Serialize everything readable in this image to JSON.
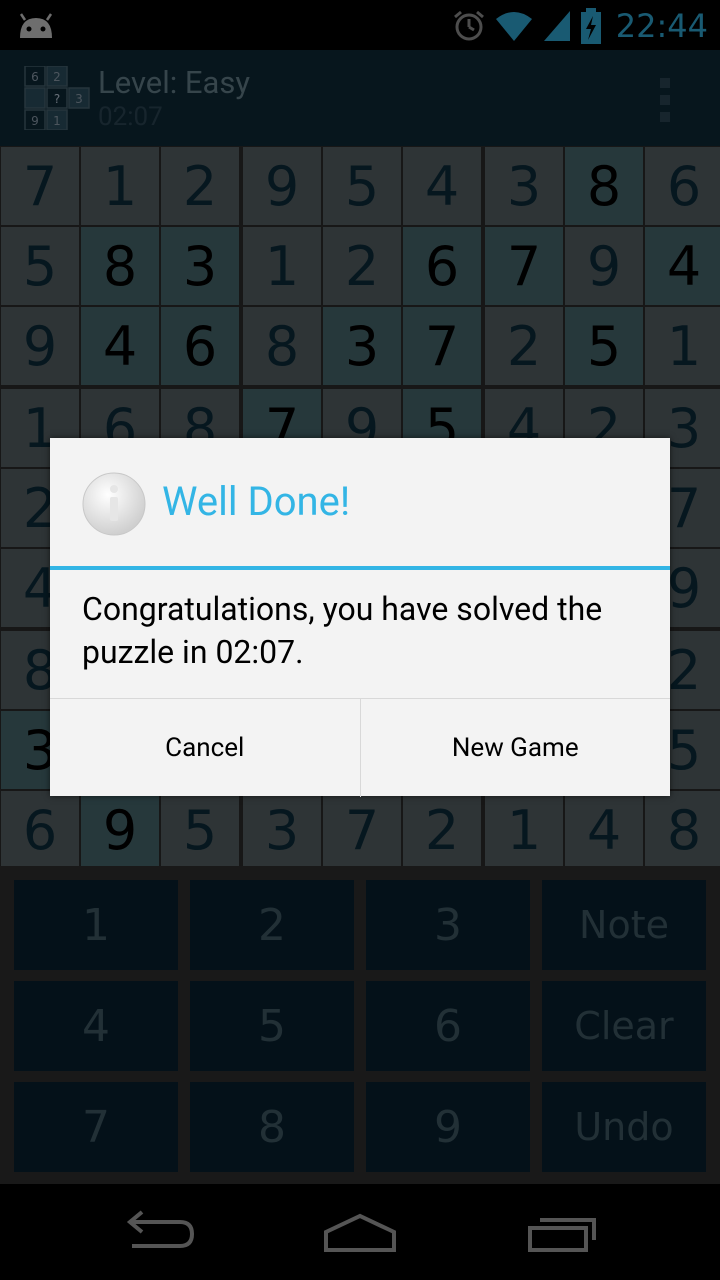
{
  "status_bar": {
    "time": "22:44",
    "icons": [
      "android-icon",
      "alarm-icon",
      "wifi-icon",
      "signal-icon",
      "battery-charging-icon"
    ]
  },
  "app_bar": {
    "title": "Level: Easy",
    "timer": "02:07",
    "logo_digits": [
      "6",
      "2",
      "?",
      "3",
      "9",
      "1"
    ],
    "menu_icon": "overflow-menu-icon"
  },
  "board": {
    "rows": [
      [
        "7",
        "1",
        "2",
        "9",
        "5",
        "4",
        "3",
        "8",
        "6"
      ],
      [
        "5",
        "8",
        "3",
        "1",
        "2",
        "6",
        "7",
        "9",
        "4"
      ],
      [
        "9",
        "4",
        "6",
        "8",
        "3",
        "7",
        "2",
        "5",
        "1"
      ],
      [
        "1",
        "6",
        "8",
        "7",
        "9",
        "5",
        "4",
        "2",
        "3"
      ],
      [
        "2",
        "",
        "",
        "",
        "",
        "",
        "",
        "",
        "7"
      ],
      [
        "4",
        "",
        "",
        "",
        "",
        "",
        "",
        "",
        "9"
      ],
      [
        "8",
        "",
        "",
        "",
        "",
        "",
        "",
        "",
        "2"
      ],
      [
        "3",
        "",
        "",
        "",
        "",
        "",
        "",
        "",
        "5"
      ],
      [
        "6",
        "9",
        "5",
        "3",
        "7",
        "2",
        "1",
        "4",
        "8"
      ]
    ],
    "user_cells": [
      [
        0,
        7
      ],
      [
        1,
        1
      ],
      [
        1,
        2
      ],
      [
        1,
        5
      ],
      [
        1,
        6
      ],
      [
        1,
        8
      ],
      [
        2,
        1
      ],
      [
        2,
        2
      ],
      [
        2,
        4
      ],
      [
        2,
        5
      ],
      [
        2,
        7
      ],
      [
        3,
        3
      ],
      [
        3,
        5
      ],
      [
        7,
        0
      ],
      [
        8,
        1
      ]
    ],
    "colors": {
      "given_bg": "#5d686c",
      "given_text": "#0d2f3f",
      "user_bg": "#4d7077",
      "user_text": "#000000"
    }
  },
  "keypad": {
    "keys": [
      "1",
      "2",
      "3",
      "Note",
      "4",
      "5",
      "6",
      "Clear",
      "7",
      "8",
      "9",
      "Undo"
    ]
  },
  "nav_bar": {
    "icons": [
      "back-icon",
      "home-icon",
      "recents-icon"
    ]
  },
  "dialog": {
    "title": "Well Done!",
    "message": "Congratulations, you have solved the puzzle in 02:07.",
    "buttons": {
      "cancel": "Cancel",
      "new_game": "New Game"
    },
    "accent": "#33b5e5"
  }
}
